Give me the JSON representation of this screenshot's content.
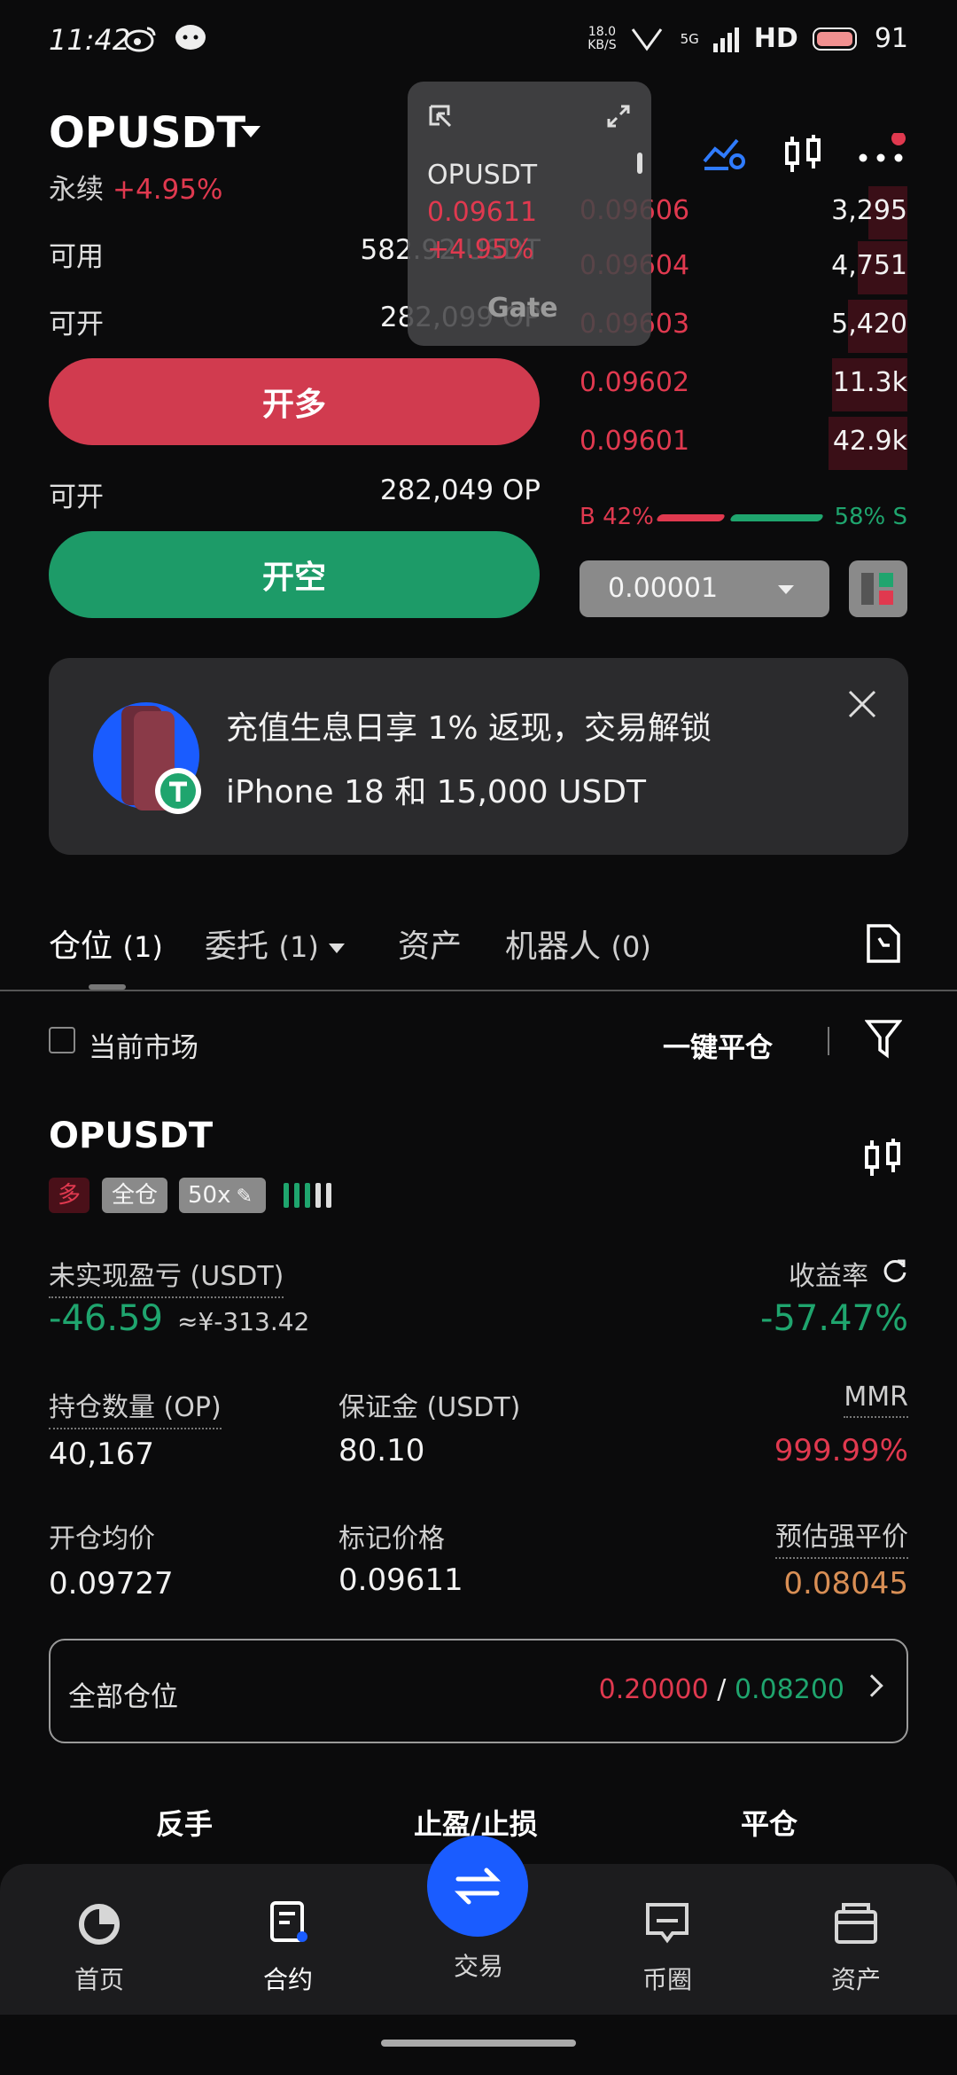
{
  "status_bar": {
    "time": "11:42",
    "net_speed": "18.0\nKB/S",
    "network": "5G",
    "hd": "HD",
    "battery": "91"
  },
  "header": {
    "symbol": "OPUSDT",
    "contract_type": "永续",
    "change": "+4.95%"
  },
  "mini_window": {
    "symbol": "OPUSDT",
    "price": "0.09611",
    "change": "+4.95%",
    "brand": "Gate"
  },
  "left_panel": {
    "available_label": "可用",
    "available_value": "582.92 USDT",
    "open_label_1": "可开",
    "open_value_1": "282,099 OP",
    "long_button": "开多",
    "open_label_2": "可开",
    "open_value_2": "282,049 OP",
    "short_button": "开空"
  },
  "order_book": {
    "asks": [
      {
        "price": "0.09606",
        "qty": "3,295",
        "depth": 0.12
      },
      {
        "price": "0.09604",
        "qty": "4,751",
        "depth": 0.15
      },
      {
        "price": "0.09603",
        "qty": "5,420",
        "depth": 0.18
      },
      {
        "price": "0.09602",
        "qty": "11.3k",
        "depth": 0.23
      },
      {
        "price": "0.09601",
        "qty": "42.9k",
        "depth": 0.24
      }
    ],
    "buy_ratio_label": "B 42%",
    "sell_ratio_label": "58% S",
    "buy_ratio": 0.42,
    "tick_size": "0.00001"
  },
  "banner": {
    "line1": "充值生息日享 1% 返现，交易解锁",
    "line2": "iPhone 18 和 15,000 USDT"
  },
  "tabs": {
    "positions": "仓位",
    "positions_count": "(1)",
    "orders": "委托",
    "orders_count": "(1)",
    "assets": "资产",
    "bots": "机器人",
    "bots_count": "(0)"
  },
  "filter": {
    "current_market": "当前市场",
    "close_all": "一键平仓"
  },
  "position": {
    "symbol": "OPUSDT",
    "side_tag": "多",
    "margin_mode_tag": "全仓",
    "leverage_tag": "50x",
    "unrealized_pnl_label": "未实现盈亏 (USDT)",
    "unrealized_pnl": "-46.59",
    "unrealized_pnl_cny": "≈¥-313.42",
    "roe_label": "收益率",
    "roe": "-57.47%",
    "size_label": "持仓数量 (OP)",
    "size": "40,167",
    "margin_label": "保证金 (USDT)",
    "margin": "80.10",
    "mmr_label": "MMR",
    "mmr": "999.99%",
    "entry_label": "开仓均价",
    "entry": "0.09727",
    "mark_label": "标记价格",
    "mark": "0.09611",
    "liq_label": "预估强平价",
    "liq": "0.08045",
    "all_positions_label": "全部仓位",
    "tp_value": "0.20000",
    "slash": "/",
    "sl_value": "0.08200",
    "action_reverse": "反手",
    "action_tpsl": "止盈/止损",
    "action_close": "平仓"
  },
  "bottom_nav": {
    "home": "首页",
    "futures": "合约",
    "trade": "交易",
    "community": "币圈",
    "assets": "资产"
  },
  "colors": {
    "red": "#e0394f",
    "green": "#1fa56e",
    "orange": "#d98f55",
    "accent_blue": "#1a5cff"
  }
}
